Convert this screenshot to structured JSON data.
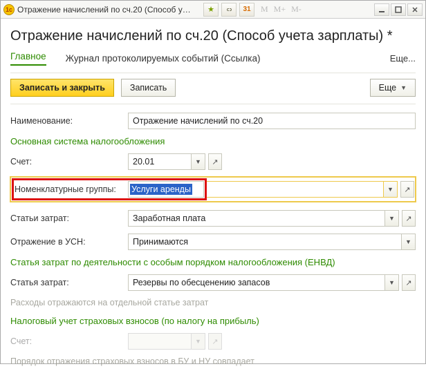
{
  "titlebar": {
    "text": "Отражение начислений по сч.20 (Способ учета зар...   (1С:Предприятие)",
    "calendar": "31",
    "m_buttons": [
      "M",
      "M+",
      "M-"
    ]
  },
  "page_title": "Отражение начислений по сч.20 (Способ учета зарплаты) *",
  "nav": {
    "main": "Главное",
    "journal": "Журнал протоколируемых событий (Ссылка)",
    "more": "Еще..."
  },
  "commands": {
    "write_close": "Записать и закрыть",
    "write": "Записать",
    "more": "Еще"
  },
  "fields": {
    "name_label": "Наименование:",
    "name_value": "Отражение начислений по сч.20",
    "section_tax_main": "Основная система налогообложения",
    "account_label": "Счет:",
    "account_value": "20.01",
    "nomgroup_label": "Номенклатурные группы:",
    "nomgroup_value": "Услуги аренды",
    "costitems_label": "Статьи затрат:",
    "costitems_value": "Заработная плата",
    "usn_label": "Отражение в УСН:",
    "usn_value": "Принимаются",
    "section_envd": "Статья затрат по деятельности с особым порядком налогообложения (ЕНВД)",
    "envd_item_label": "Статья затрат:",
    "envd_item_value": "Резервы по обесценению запасов",
    "envd_hint": "Расходы отражаются на отдельной статье затрат",
    "section_profit": "Налоговый учет страховых взносов (по налогу на прибыль)",
    "profit_account_label": "Счет:",
    "profit_account_value": "",
    "profit_hint": "Порядок отражения страховых взносов в БУ и НУ совпадает"
  }
}
